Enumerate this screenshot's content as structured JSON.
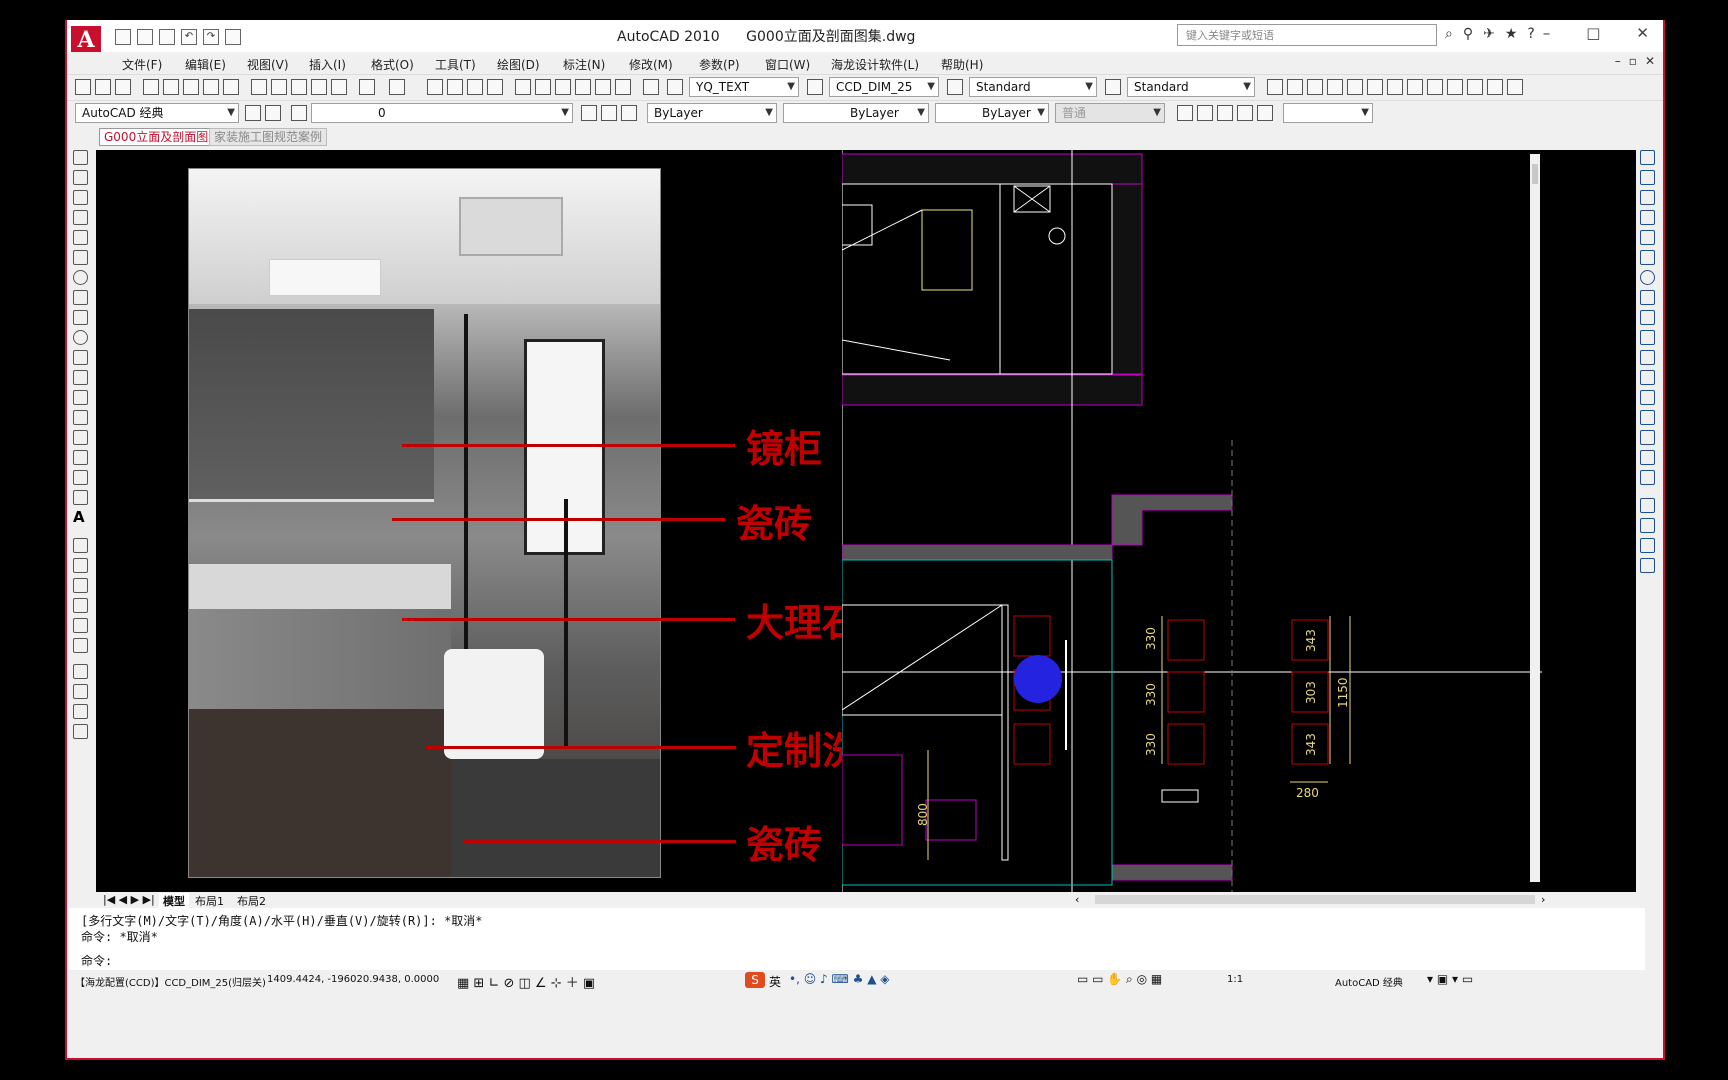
{
  "app": {
    "name": "AutoCAD 2010",
    "document": "G000立面及剖面图集.dwg",
    "search_placeholder": "键入关键字或短语",
    "win_controls": [
      "–",
      "□",
      "✕"
    ]
  },
  "menu": [
    "文件(F)",
    "编辑(E)",
    "视图(V)",
    "插入(I)",
    "格式(O)",
    "工具(T)",
    "绘图(D)",
    "标注(N)",
    "修改(M)",
    "参数(P)",
    "窗口(W)",
    "海龙设计软件(L)",
    "帮助(H)"
  ],
  "styles_toolbar": {
    "text_style": "YQ_TEXT",
    "dim_style": "CCD_DIM_25",
    "table_style": "Standard",
    "mleader_style": "Standard"
  },
  "layers_toolbar": {
    "workspace": "AutoCAD 经典",
    "layer": "0",
    "color": "ByLayer",
    "linetype": "ByLayer",
    "lineweight": "ByLayer",
    "plotstyle": "普通"
  },
  "file_tabs": [
    "G000立面及剖面图集",
    "家装施工图规范案例"
  ],
  "annotations": {
    "mirror_cabinet": "镜柜",
    "tile_wall": "瓷砖",
    "marble": "大理石",
    "custom_vanity": "定制洗漱",
    "tile_floor": "瓷砖"
  },
  "dimensions": {
    "left_col": [
      "330",
      "330",
      "330"
    ],
    "right_col": [
      "343",
      "303",
      "343"
    ],
    "total": "1150",
    "width": "280",
    "height": "800"
  },
  "layout_tabs": [
    "模型",
    "布局1",
    "布局2"
  ],
  "command": {
    "history_1": "[多行文字(M)/文字(T)/角度(A)/水平(H)/垂直(V)/旋转(R)]: *取消*",
    "history_2": "命令: *取消*",
    "prompt": "命令:"
  },
  "status": {
    "left": "【海龙配置(CCD)】CCD_DIM_25(归层关)",
    "coords": "1409.4424, -196020.9438, 0.0000",
    "ime": "英",
    "scale": "1:1",
    "workspace": "AutoCAD 经典"
  },
  "colors": {
    "accent": "#c8102e",
    "annotation": "#c00000",
    "canvas": "#000000",
    "dim": "#e8d87c",
    "magenta": "#c000c0",
    "cursor": "#2323e0"
  }
}
